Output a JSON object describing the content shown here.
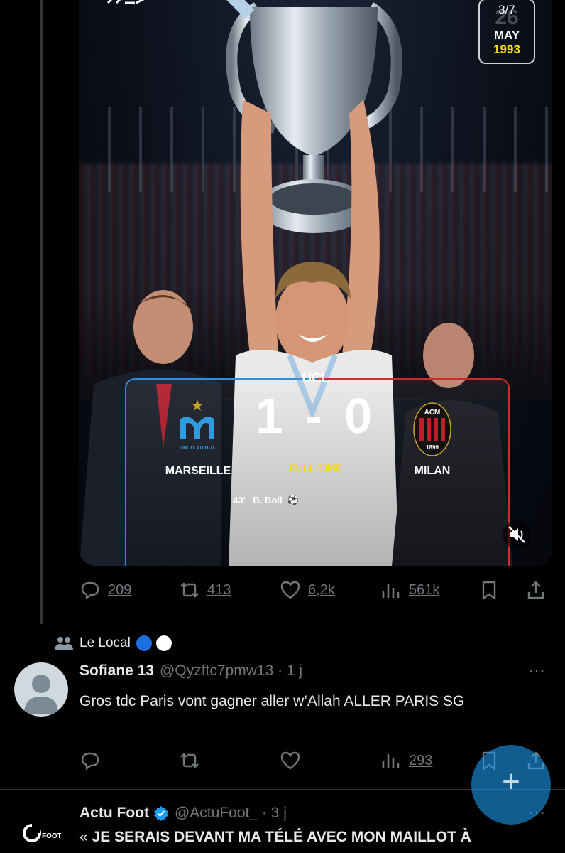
{
  "post": {
    "media": {
      "brand": "",
      "date_badge": {
        "fraction": "3/7",
        "day": "26",
        "month": "MAY",
        "year": "1993"
      },
      "competition": "UCL",
      "score": "1 - 0",
      "status": "FULL-TIME",
      "home_team": "MARSEILLE",
      "away_team": "MILAN",
      "home_crest_text": "DROIT AU BUT",
      "away_crest_text": {
        "top": "ACM",
        "bottom": "1899"
      },
      "scorer_minute": "43'",
      "scorer_name": "B. Boli",
      "colors": {
        "home": "#2f8fdc",
        "away": "#d02b2b",
        "highlight": "#f5d90a"
      }
    },
    "actions": {
      "replies": "209",
      "reposts": "413",
      "likes": "6,2k",
      "views": "561k"
    }
  },
  "social_context": {
    "label": "Le Local",
    "dots": [
      "#1d6fe0",
      "#ffffff"
    ]
  },
  "reply": {
    "name": "Sofiane 13",
    "handle": "@Qyzftc7pmw13 · 1 j",
    "more": "···",
    "text": "Gros tdc Paris vont gagner aller w’Allah ALLER PARIS SG",
    "actions": {
      "views": "293"
    }
  },
  "next_tweet": {
    "name": "Actu Foot",
    "handle": "@ActuFoot_ · 3 j",
    "more": "···",
    "logo_text": "FOOT",
    "text_open": "«",
    "text": "JE SERAIS DEVANT MA TÉLÉ AVEC MON MAILLOT À"
  },
  "fab": {
    "label": "+"
  }
}
